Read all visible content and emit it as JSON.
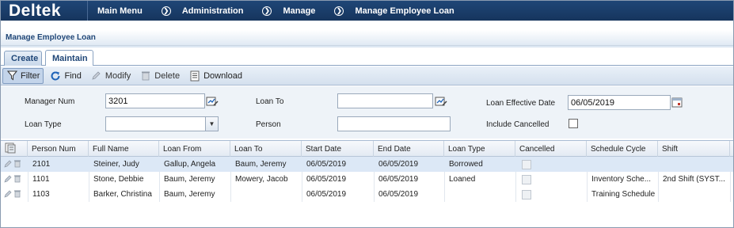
{
  "brand": "Deltek",
  "breadcrumb": [
    "Main Menu",
    "Administration",
    "Manage",
    "Manage Employee Loan"
  ],
  "page_title": "Manage Employee Loan",
  "tabs": [
    {
      "label": "Create",
      "active": false
    },
    {
      "label": "Maintain",
      "active": true
    }
  ],
  "toolbar": {
    "filter": "Filter",
    "find": "Find",
    "modify": "Modify",
    "delete": "Delete",
    "download": "Download"
  },
  "form": {
    "manager_num_label": "Manager Num",
    "manager_num_value": "3201",
    "loan_to_label": "Loan To",
    "loan_to_value": "",
    "loan_effective_date_label": "Loan Effective Date",
    "loan_effective_date_value": "06/05/2019",
    "loan_type_label": "Loan Type",
    "loan_type_value": "",
    "person_label": "Person",
    "person_value": "",
    "include_cancelled_label": "Include Cancelled",
    "include_cancelled_checked": false
  },
  "grid": {
    "columns": [
      "Person Num",
      "Full Name",
      "Loan From",
      "Loan To",
      "Start Date",
      "End Date",
      "Loan Type",
      "Cancelled",
      "Schedule Cycle",
      "Shift"
    ],
    "rows": [
      {
        "person_num": "2101",
        "full_name": "Steiner, Judy",
        "loan_from": "Gallup, Angela",
        "loan_to": "Baum, Jeremy",
        "start_date": "06/05/2019",
        "end_date": "06/05/2019",
        "loan_type": "Borrowed",
        "schedule_cycle": "",
        "shift": "",
        "selected": true
      },
      {
        "person_num": "1101",
        "full_name": "Stone, Debbie",
        "loan_from": "Baum, Jeremy",
        "loan_to": "Mowery, Jacob",
        "start_date": "06/05/2019",
        "end_date": "06/05/2019",
        "loan_type": "Loaned",
        "schedule_cycle": "Inventory Sche...",
        "shift": "2nd Shift (SYST...",
        "selected": false
      },
      {
        "person_num": "1103",
        "full_name": "Barker, Christina",
        "loan_from": "Baum, Jeremy",
        "loan_to": "",
        "start_date": "06/05/2019",
        "end_date": "06/05/2019",
        "loan_type": "",
        "schedule_cycle": "Training Schedule",
        "shift": "",
        "selected": false
      }
    ]
  },
  "colors": {
    "topbar": "#1f4677",
    "accent": "#1f4677",
    "selected_row": "#dce8f6"
  }
}
